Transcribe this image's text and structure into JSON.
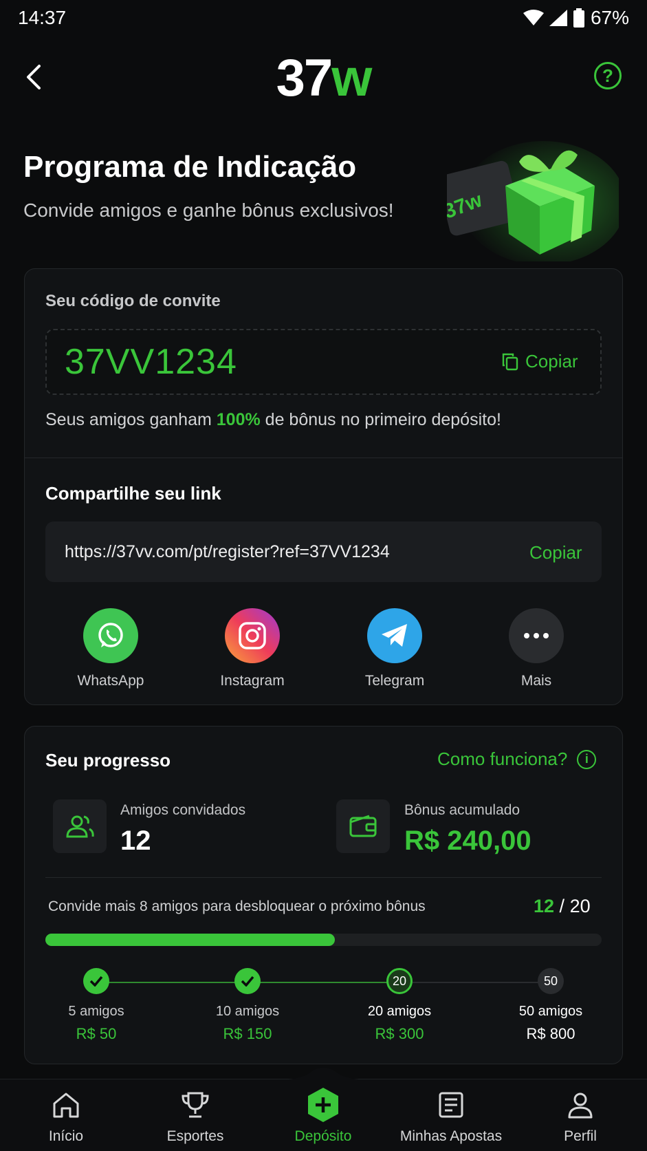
{
  "status_bar": {
    "time": "14:37",
    "battery": "67%"
  },
  "header": {
    "logo_main": "37",
    "logo_accent": "w",
    "help_symbol": "?"
  },
  "hero": {
    "title": "Programa de Indicação",
    "subtitle": "Convide amigos e ganhe bônus exclusivos!",
    "gift_card_text": "37w"
  },
  "invite": {
    "label": "Seu código de convite",
    "code": "37VV1234",
    "copy_label": "Copiar",
    "friends_prefix": "Seus amigos ganham ",
    "friends_pct": "100%",
    "friends_suffix": " de bônus no primeiro depósito!"
  },
  "share": {
    "title": "Compartilhe seu link",
    "link": "https://37vv.com/pt/register?ref=37VV1234",
    "copy_label": "Copiar",
    "apps": [
      {
        "label": "WhatsApp",
        "icon": "whatsapp-icon",
        "color": "#25d366"
      },
      {
        "label": "Instagram",
        "icon": "instagram-icon",
        "color": "#e1306c"
      },
      {
        "label": "Telegram",
        "icon": "telegram-icon",
        "color": "#2aa3e6"
      },
      {
        "label": "Mais",
        "icon": "more-icon",
        "color": "#2a2c2f"
      }
    ]
  },
  "progress": {
    "title": "Seu progresso",
    "how_label": "Como funciona?",
    "friends_label": "Amigos convidados",
    "friends_value": "12",
    "bonus_label": "Bônus acumulado",
    "bonus_value": "R$ 240,00",
    "invite_more": "Convide mais 8 amigos para desbloquear o próximo bônus",
    "current": "12",
    "separator": " / ",
    "target": "20",
    "fraction": 0.52,
    "milestones": [
      {
        "label": "5 amigos",
        "reward": "R$ 50",
        "state": "done",
        "badge": ""
      },
      {
        "label": "10 amigos",
        "reward": "R$ 150",
        "state": "done",
        "badge": ""
      },
      {
        "label": "20 amigos",
        "reward": "R$ 300",
        "state": "current",
        "badge": "20"
      },
      {
        "label": "50 amigos",
        "reward": "R$ 800",
        "state": "locked",
        "badge": "50"
      }
    ]
  },
  "nav": {
    "items": [
      {
        "label": "Início",
        "icon": "home-icon"
      },
      {
        "label": "Esportes",
        "icon": "trophy-icon"
      },
      {
        "label": "Depósito",
        "icon": "deposit-plus-icon"
      },
      {
        "label": "Minhas Apostas",
        "icon": "bets-list-icon"
      },
      {
        "label": "Perfil",
        "icon": "profile-icon"
      }
    ],
    "active_index": 2
  },
  "colors": {
    "accent": "#3ac53a",
    "background": "#0b0c0d",
    "card": "#111315"
  }
}
